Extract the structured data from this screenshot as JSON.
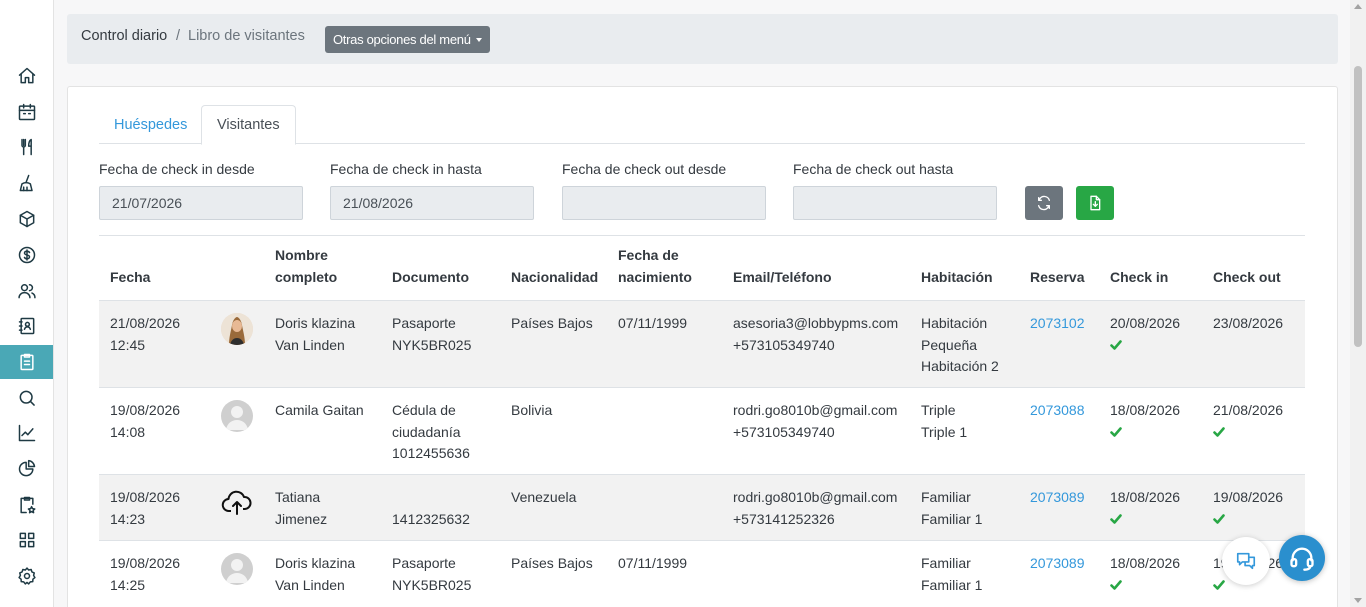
{
  "breadcrumb": {
    "item1": "Control diario",
    "separator": "/",
    "item2": "Libro de visitantes",
    "menu_button": "Otras opciones del menú"
  },
  "sidebar": {
    "icons": [
      "home-icon",
      "calendar-icon",
      "restaurant-icon",
      "housekeeping-icon",
      "inventory-box-icon",
      "payments-dollar-icon",
      "guests-users-icon",
      "contacts-book-icon",
      "clipboard-icon",
      "search-icon",
      "chart-line-icon",
      "pie-chart-icon",
      "clipboard-star-icon",
      "apps-grid-icon",
      "settings-gear-icon"
    ],
    "active": "clipboard-icon"
  },
  "tabs": [
    {
      "label": "Huéspedes",
      "active": false
    },
    {
      "label": "Visitantes",
      "active": true
    }
  ],
  "filters": {
    "checkin_from": {
      "label": "Fecha de check in desde",
      "value": "21/07/2026"
    },
    "checkin_to": {
      "label": "Fecha de check in hasta",
      "value": "21/08/2026"
    },
    "checkout_from": {
      "label": "Fecha de check out desde",
      "value": ""
    },
    "checkout_to": {
      "label": "Fecha de check out hasta",
      "value": ""
    }
  },
  "buttons": {
    "refresh_icon": "refresh-icon",
    "export_icon": "export-excel-icon"
  },
  "table": {
    "headers": {
      "fecha": "Fecha",
      "nombre_1": "Nombre",
      "nombre_2": "completo",
      "documento": "Documento",
      "nacionalidad": "Nacionalidad",
      "nacimiento_1": "Fecha de",
      "nacimiento_2": "nacimiento",
      "email": "Email/Teléfono",
      "habitacion": "Habitación",
      "reserva": "Reserva",
      "checkin": "Check in",
      "checkout": "Check out"
    },
    "rows": [
      {
        "fecha_1": "21/08/2026",
        "fecha_2": "12:45",
        "avatar": "photo",
        "nombre_1": "Doris klazina",
        "nombre_2": "Van Linden",
        "doc_1": "Pasaporte",
        "doc_2": "NYK5BR025",
        "doc_3": "",
        "nacionalidad": "Países Bajos",
        "nacimiento": "07/11/1999",
        "email": "asesoria3@lobbypms.com",
        "telefono": "+573105349740",
        "hab_1": "Habitación",
        "hab_2": "Pequeña",
        "hab_3": "Habitación 2",
        "reserva": "2073102",
        "checkin": "20/08/2026",
        "checkout": "23/08/2026"
      },
      {
        "fecha_1": "19/08/2026",
        "fecha_2": "14:08",
        "avatar": "default",
        "nombre_1": "Camila Gaitan",
        "nombre_2": "",
        "doc_1": "Cédula de",
        "doc_2": "ciudadanía",
        "doc_3": "1012455636",
        "nacionalidad": "Bolivia",
        "nacimiento": "",
        "email": "rodri.go8010b@gmail.com",
        "telefono": "+573105349740",
        "hab_1": "Triple",
        "hab_2": "Triple 1",
        "hab_3": "",
        "reserva": "2073088",
        "checkin": "18/08/2026",
        "checkout": "21/08/2026"
      },
      {
        "fecha_1": "19/08/2026",
        "fecha_2": "14:23",
        "avatar": "upload",
        "nombre_1": "Tatiana",
        "nombre_2": "Jimenez",
        "doc_1": "",
        "doc_2": "1412325632",
        "doc_3": "",
        "nacionalidad": "Venezuela",
        "nacimiento": "",
        "email": "rodri.go8010b@gmail.com",
        "telefono": "+573141252326",
        "hab_1": "Familiar",
        "hab_2": "Familiar 1",
        "hab_3": "",
        "reserva": "2073089",
        "checkin": "18/08/2026",
        "checkout": "19/08/2026"
      },
      {
        "fecha_1": "19/08/2026",
        "fecha_2": "14:25",
        "avatar": "default",
        "nombre_1": "Doris klazina",
        "nombre_2": "Van Linden",
        "doc_1": "Pasaporte",
        "doc_2": "NYK5BR025",
        "doc_3": "",
        "nacionalidad": "Países Bajos",
        "nacimiento": "07/11/1999",
        "email": "",
        "telefono": "",
        "hab_1": "Familiar",
        "hab_2": "Familiar 1",
        "hab_3": "",
        "reserva": "2073089",
        "checkin": "18/08/2026",
        "checkout": "19/08/2026"
      }
    ]
  },
  "floating": {
    "chat_icon": "chat-bubbles-icon",
    "support_icon": "headset-support-icon"
  },
  "colors": {
    "accent": "#4aa8b6",
    "link": "#3498db",
    "success": "#28a745",
    "secondary": "#6c757d"
  }
}
